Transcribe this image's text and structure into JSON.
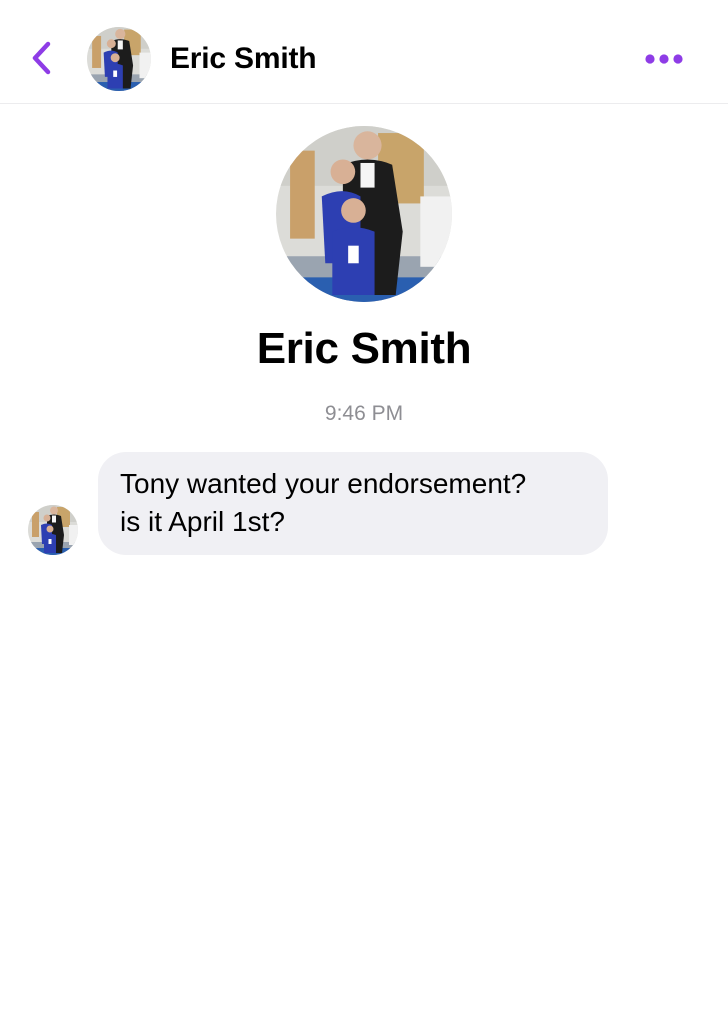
{
  "header": {
    "contact_name": "Eric Smith",
    "back_icon": "chevron-left-icon",
    "more_icon": "ellipsis-icon"
  },
  "profile": {
    "name": "Eric Smith"
  },
  "conversation": {
    "timestamp": "9:46 PM",
    "messages": [
      {
        "sender": "Eric Smith",
        "lines": [
          "Tony wanted your endorsement?",
          "is it April 1st?"
        ]
      }
    ]
  },
  "colors": {
    "accent": "#8e3ce6",
    "bubble": "#f0f0f4",
    "timestamp": "#8e8e93"
  }
}
